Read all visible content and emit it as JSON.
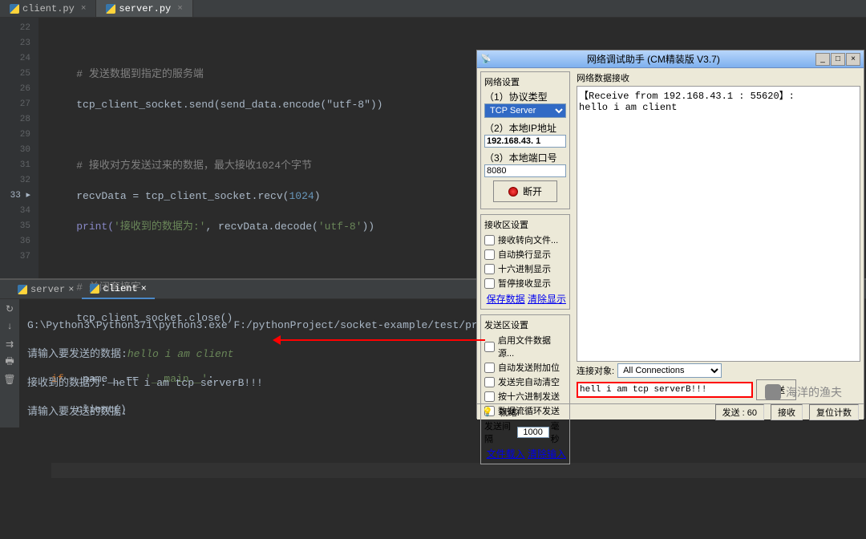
{
  "editor_tabs": [
    {
      "label": "client.py",
      "active": false
    },
    {
      "label": "server.py",
      "active": true
    }
  ],
  "line_numbers": [
    "22",
    "23",
    "24",
    "25",
    "26",
    "27",
    "28",
    "29",
    "30",
    "31",
    "32",
    "33",
    "34",
    "35",
    "36",
    "37"
  ],
  "code": {
    "l23_comment": "# 发送数据到指定的服务端",
    "l24": "tcp_client_socket.send(send_data.encode(\"utf-8\"))",
    "l26_comment": "# 接收对方发送过来的数据，最大接收1024个字节",
    "l27_a": "recvData = tcp_client_socket.recv(",
    "l27_num": "1024",
    "l27_b": ")",
    "l28_a": "print(",
    "l28_str1": "'接收到的数据为:'",
    "l28_b": ", recvData.decode(",
    "l28_str2": "'utf-8'",
    "l28_c": "))",
    "l30_comment": "# 关闭套接字",
    "l31": "tcp_client_socket.close()",
    "l33_a": "if",
    "l33_b": " __name__ == ",
    "l33_str": "'__main__'",
    "l33_c": ":",
    "l34": "client()"
  },
  "console_tabs": [
    {
      "label": "server",
      "active": false
    },
    {
      "label": "client",
      "active": true
    }
  ],
  "console": {
    "line1": "G:\\Python3\\Python371\\python3.exe F:/pythonProject/socket-example/test/proxy.",
    "line2_prompt": "请输入要发送的数据:",
    "line2_input": "hello i am client",
    "line3": "接收到的数据为: hell i am tcp serverB!!!",
    "line4": "请输入要发送的数据:"
  },
  "dialog": {
    "title": "网络调试助手 (CM精装版 V3.7)",
    "net_settings": "网络设置",
    "proto_label": "（1）协议类型",
    "proto_value": "TCP Server",
    "ip_label": "（2）本地IP地址",
    "ip_value": "192.168.43. 1",
    "port_label": "（3）本地端口号",
    "port_value": "8080",
    "disconnect": "断开",
    "recv_settings": "接收区设置",
    "recv_opts": [
      "接收转向文件...",
      "自动换行显示",
      "十六进制显示",
      "暂停接收显示"
    ],
    "recv_links": {
      "save": "保存数据",
      "clear": "清除显示"
    },
    "send_settings": "发送区设置",
    "send_opts": [
      "启用文件数据源...",
      "自动发送附加位",
      "发送完自动清空",
      "按十六进制发送",
      "数据流循环发送"
    ],
    "interval_label": "发送间隔",
    "interval_value": "1000",
    "interval_unit": "毫秒",
    "file_load": "文件载入",
    "clear_input": "清除输入",
    "recv_title": "网络数据接收",
    "recv_text": "【Receive from 192.168.43.1 : 55620】:\nhello i am client",
    "conn_target_label": "连接对象:",
    "conn_target": "All Connections",
    "send_input": "hell i am tcp serverB!!!",
    "send_btn": "发送",
    "status_ready": "就绪!",
    "status_send": "发送 : 60",
    "status_recv": "接收",
    "status_reset": "复位计数"
  },
  "watermark": "海洋的渔夫"
}
